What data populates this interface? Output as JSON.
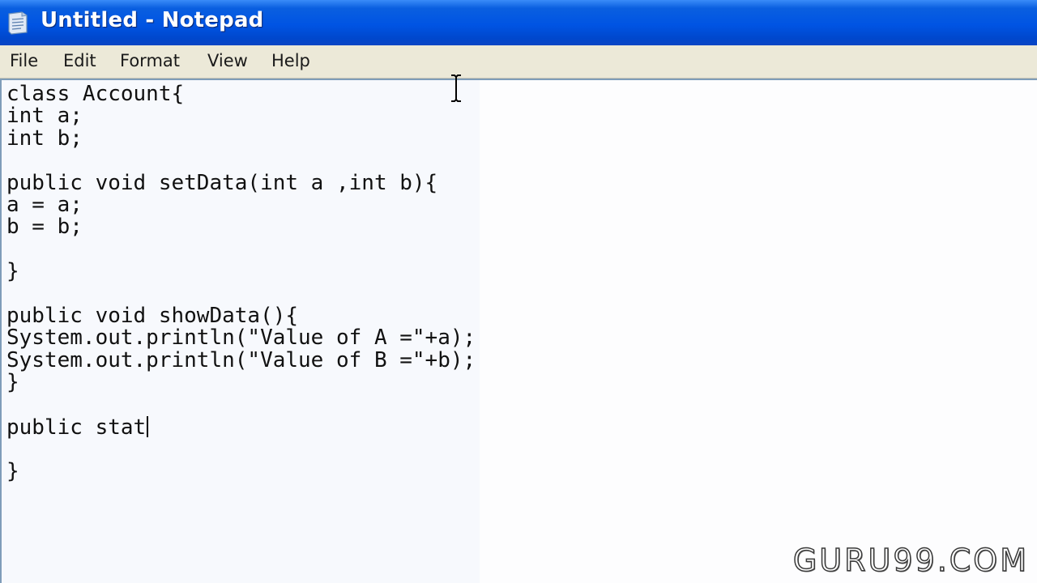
{
  "window": {
    "title": "Untitled - Notepad",
    "title_bar_color": "#0054e3"
  },
  "menubar": {
    "items": [
      "File",
      "Edit",
      "Format",
      "View",
      "Help"
    ]
  },
  "editor": {
    "lines": [
      "class Account{",
      "int a;",
      "int b;",
      "",
      "public void setData(int a ,int b){",
      "a = a;",
      "b = b;",
      "",
      "}",
      "",
      "public void showData(){",
      "System.out.println(\"Value of A =\"+a);",
      "System.out.println(\"Value of B =\"+b);",
      "}",
      "",
      "public stat",
      "",
      "}"
    ],
    "caret_line": 15
  },
  "watermark": {
    "text": "GURU99.COM"
  },
  "icons": {
    "app": "notepad-icon",
    "cursor": "i-beam-cursor-icon"
  }
}
